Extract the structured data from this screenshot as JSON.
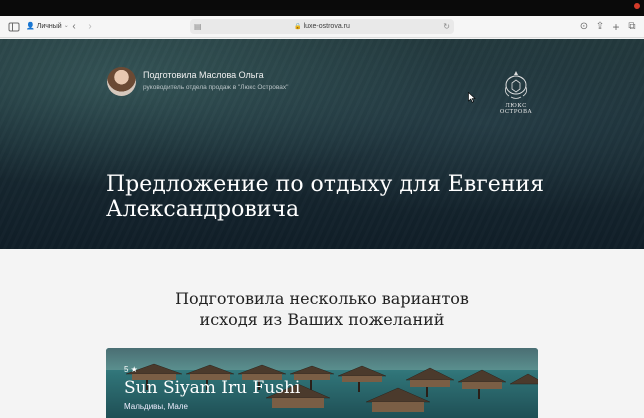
{
  "browser": {
    "profile_label": "Личный",
    "url": "luxe-ostrova.ru"
  },
  "hero": {
    "prepared_by": "Подготовила Маслова Ольга",
    "role": "руководитель отдела продаж в \"Люкс Островах\"",
    "brand_name": "ЛЮКС ОСТРОВА",
    "title": "Предложение по отдыху для Евгения Александровича"
  },
  "section": {
    "subtitle_line1": "Подготовила несколько вариантов",
    "subtitle_line2": "исходя из Ваших пожеланий"
  },
  "hotel": {
    "stars": "5 ★",
    "name": "Sun Siyam Iru Fushi",
    "location": "Мальдивы, Мале"
  },
  "colors": {
    "hero_bg": "#1a2d35",
    "page_bg": "#f4f4f4",
    "toolbar_bg": "#f6f6f6"
  }
}
